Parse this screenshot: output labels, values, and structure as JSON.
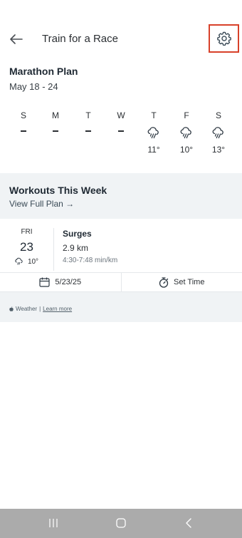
{
  "header": {
    "title": "Train for a Race",
    "back_icon": "arrow-left-icon",
    "settings_icon": "gear-icon",
    "settings_highlight_color": "#d8412a"
  },
  "plan": {
    "title": "Marathon Plan",
    "dates": "May 18 - 24"
  },
  "days": [
    {
      "letter": "S",
      "has_weather": false,
      "temp": ""
    },
    {
      "letter": "M",
      "has_weather": false,
      "temp": ""
    },
    {
      "letter": "T",
      "has_weather": false,
      "temp": ""
    },
    {
      "letter": "W",
      "has_weather": false,
      "temp": ""
    },
    {
      "letter": "T",
      "has_weather": true,
      "temp": "11°"
    },
    {
      "letter": "F",
      "has_weather": true,
      "temp": "10°"
    },
    {
      "letter": "S",
      "has_weather": true,
      "temp": "13°"
    }
  ],
  "workouts": {
    "title": "Workouts This Week",
    "view_full_plan": "View Full Plan →",
    "items": [
      {
        "dow": "FRI",
        "date": "23",
        "temp": "10°",
        "name": "Surges",
        "distance": "2.9 km",
        "pace": "4:30-7:48 min/km",
        "date_button": "5/23/25",
        "time_button": "Set Time"
      }
    ]
  },
  "attribution": {
    "weather": "Weather",
    "separator": "|",
    "learn_more": "Learn more"
  }
}
